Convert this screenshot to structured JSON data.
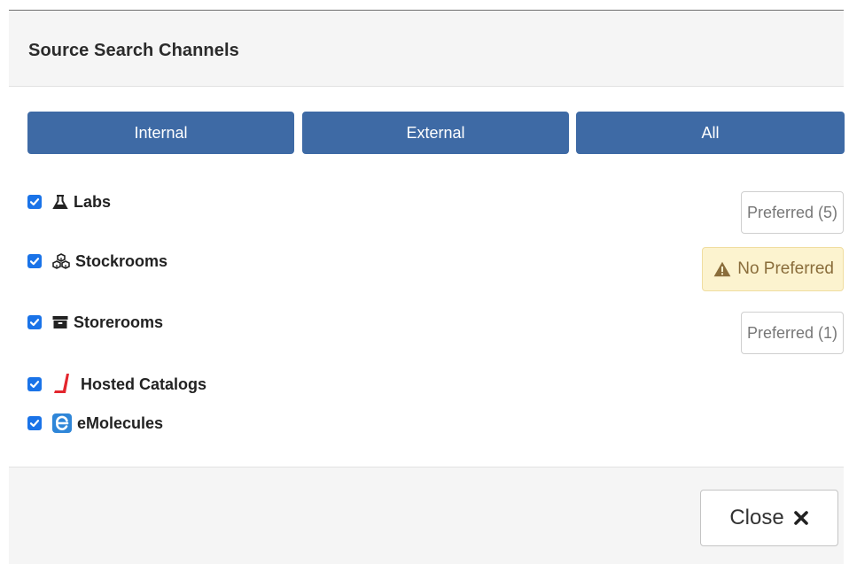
{
  "dialog": {
    "title": "Source Search Channels",
    "close_label": "Close",
    "close_icon": "times-icon"
  },
  "filters": {
    "internal": "Internal",
    "external": "External",
    "all": "All"
  },
  "channels": [
    {
      "label": "Labs",
      "checked": true,
      "icon": "flask-icon",
      "preferred": "Preferred (5)"
    },
    {
      "label": "Stockrooms",
      "checked": true,
      "icon": "cubes-icon",
      "warning": "No Preferred",
      "warning_icon": "warning-icon"
    },
    {
      "label": "Storerooms",
      "checked": true,
      "icon": "archive-icon",
      "preferred": "Preferred (1)"
    },
    {
      "label": "Hosted Catalogs",
      "checked": true,
      "icon": "hosted-catalogs-logo-icon"
    },
    {
      "label": "eMolecules",
      "checked": true,
      "icon": "emolecules-logo-icon"
    }
  ],
  "colors": {
    "button_blue": "#3e6aa5",
    "checkbox_blue": "#1a73e8",
    "warning_bg": "#fcf3cf",
    "warning_text": "#8a6d3b",
    "hosted_red": "#e3262e",
    "emolecules_blue": "#2f86d8"
  }
}
